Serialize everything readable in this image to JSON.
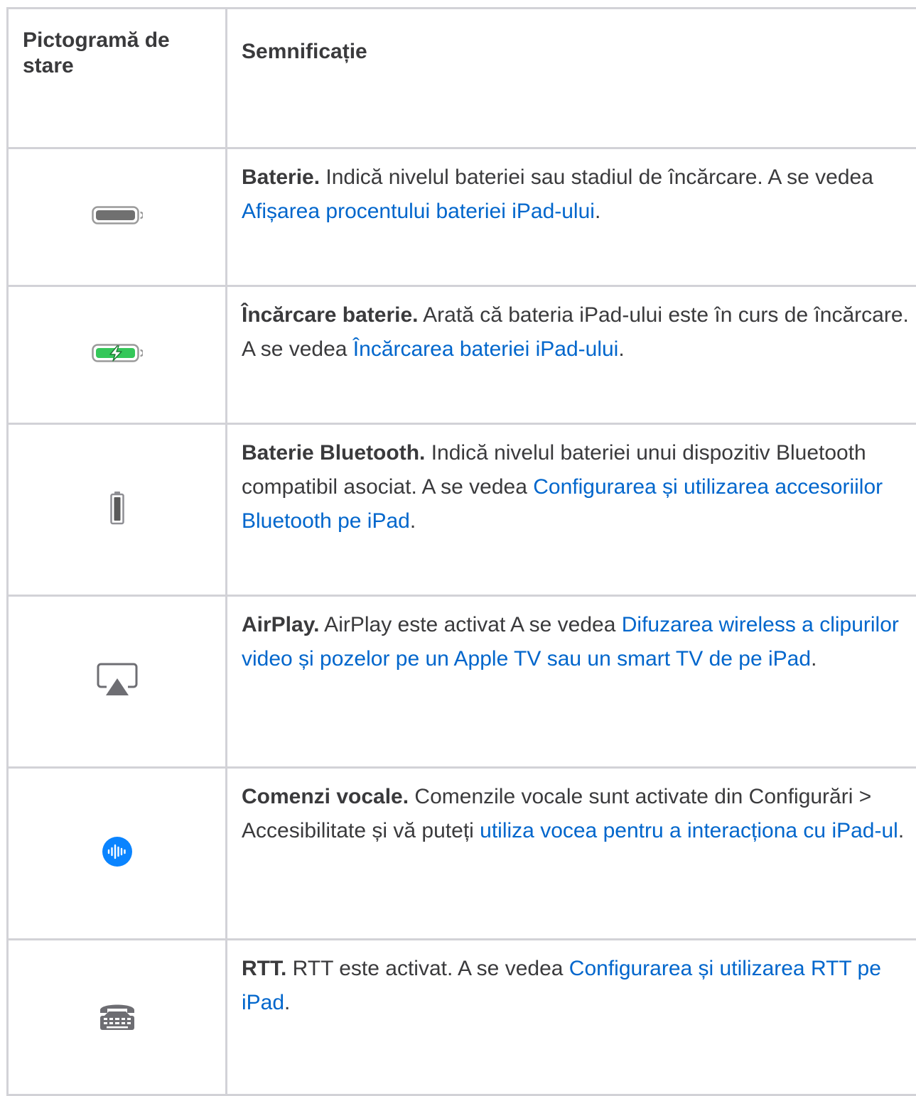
{
  "table": {
    "header": {
      "icon_col": "Pictogramă de stare",
      "meaning_col": "Semnificație"
    },
    "rows": [
      {
        "icon": "battery-icon",
        "title": "Baterie.",
        "text": " Indică nivelul bateriei sau stadiul de încărcare. A se vedea ",
        "link": "Afișarea procentului bateriei iPad-ului",
        "suffix": "."
      },
      {
        "icon": "battery-charging-icon",
        "title": "Încărcare baterie.",
        "text": " Arată că bateria iPad-ului este în curs de încărcare. A se vedea ",
        "link": "Încărcarea bateriei iPad-ului",
        "suffix": "."
      },
      {
        "icon": "bluetooth-battery-icon",
        "title": "Baterie Bluetooth.",
        "text": " Indică nivelul bateriei unui dispozitiv Bluetooth compatibil asociat. A se vedea ",
        "link": "Configurarea și utilizarea accesoriilor Bluetooth pe iPad",
        "suffix": "."
      },
      {
        "icon": "airplay-icon",
        "title": "AirPlay.",
        "text": " AirPlay este activat A se vedea ",
        "link": "Difuzarea wireless a clipurilor video și pozelor pe un Apple TV sau un smart TV de pe iPad",
        "suffix": "."
      },
      {
        "icon": "voice-control-icon",
        "title": "Comenzi vocale.",
        "text": " Comenzile vocale sunt activate din Configurări > Accesibilitate și vă puteți ",
        "link": "utiliza vocea pentru a interacționa cu iPad-ul",
        "suffix": "."
      },
      {
        "icon": "rtt-icon",
        "title": "RTT.",
        "text": " RTT este activat. A se vedea ",
        "link": "Configurarea și utilizarea RTT pe iPad",
        "suffix": "."
      }
    ]
  },
  "colors": {
    "text": "#3a3a3c",
    "link": "#0066cc",
    "border": "#d2d2d7",
    "battery_green": "#34c759",
    "voice_blue": "#0a84ff",
    "icon_gray": "#707070"
  }
}
